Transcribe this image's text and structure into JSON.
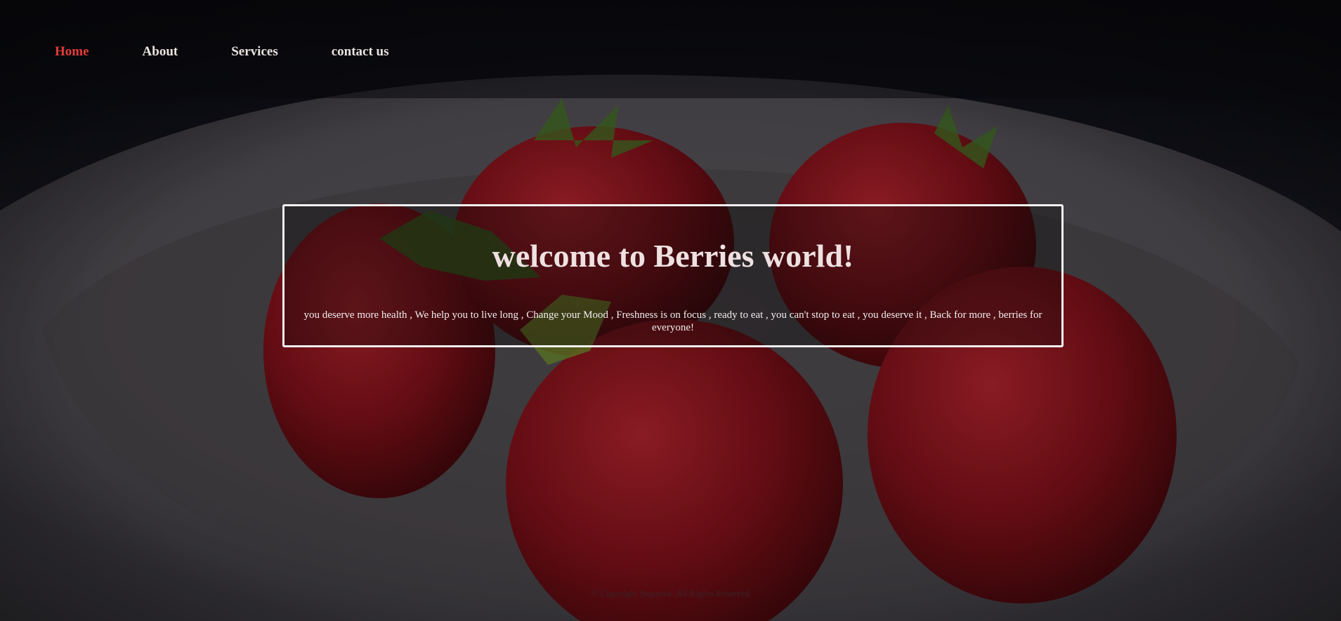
{
  "nav": {
    "items": [
      {
        "label": "Home",
        "active": true
      },
      {
        "label": "About",
        "active": false
      },
      {
        "label": "Services",
        "active": false
      },
      {
        "label": "contact us",
        "active": false
      }
    ]
  },
  "hero": {
    "title": "welcome to Berries world!",
    "text": "you deserve more health , We help you to live long , Change your Mood , Freshness is on focus , ready to eat , you can't stop to eat , you deserve it , Back for more , berries for everyone!"
  },
  "footer": {
    "copyright": "© Copyright Sagarika. All Rights Reserved"
  },
  "background": {
    "image": "strawberries-on-plate-photo",
    "colors": {
      "backdrop": "#0d0d12",
      "plate": "#5e5a5d",
      "berry": "#7a1018",
      "leaf": "#3f6a22"
    }
  },
  "colors": {
    "nav_text": "#e9e3df",
    "nav_active": "#e23b3b",
    "hero_border": "#f2f2f2",
    "hero_title": "#efe1e1"
  }
}
